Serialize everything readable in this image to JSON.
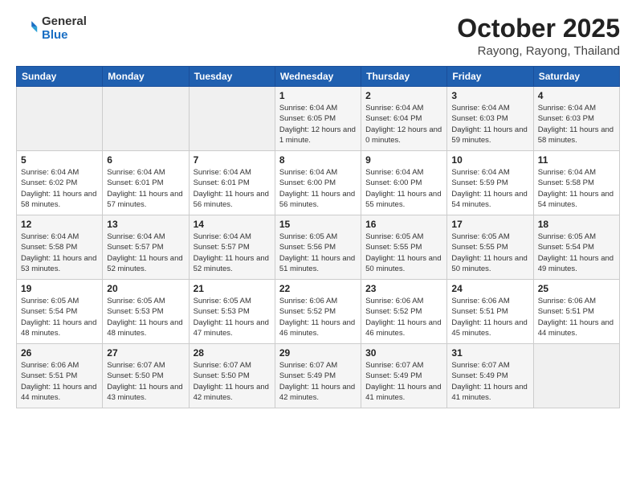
{
  "logo": {
    "general": "General",
    "blue": "Blue"
  },
  "header": {
    "month": "October 2025",
    "location": "Rayong, Rayong, Thailand"
  },
  "weekdays": [
    "Sunday",
    "Monday",
    "Tuesday",
    "Wednesday",
    "Thursday",
    "Friday",
    "Saturday"
  ],
  "weeks": [
    [
      {
        "day": "",
        "sunrise": "",
        "sunset": "",
        "daylight": ""
      },
      {
        "day": "",
        "sunrise": "",
        "sunset": "",
        "daylight": ""
      },
      {
        "day": "",
        "sunrise": "",
        "sunset": "",
        "daylight": ""
      },
      {
        "day": "1",
        "sunrise": "Sunrise: 6:04 AM",
        "sunset": "Sunset: 6:05 PM",
        "daylight": "Daylight: 12 hours and 1 minute."
      },
      {
        "day": "2",
        "sunrise": "Sunrise: 6:04 AM",
        "sunset": "Sunset: 6:04 PM",
        "daylight": "Daylight: 12 hours and 0 minutes."
      },
      {
        "day": "3",
        "sunrise": "Sunrise: 6:04 AM",
        "sunset": "Sunset: 6:03 PM",
        "daylight": "Daylight: 11 hours and 59 minutes."
      },
      {
        "day": "4",
        "sunrise": "Sunrise: 6:04 AM",
        "sunset": "Sunset: 6:03 PM",
        "daylight": "Daylight: 11 hours and 58 minutes."
      }
    ],
    [
      {
        "day": "5",
        "sunrise": "Sunrise: 6:04 AM",
        "sunset": "Sunset: 6:02 PM",
        "daylight": "Daylight: 11 hours and 58 minutes."
      },
      {
        "day": "6",
        "sunrise": "Sunrise: 6:04 AM",
        "sunset": "Sunset: 6:01 PM",
        "daylight": "Daylight: 11 hours and 57 minutes."
      },
      {
        "day": "7",
        "sunrise": "Sunrise: 6:04 AM",
        "sunset": "Sunset: 6:01 PM",
        "daylight": "Daylight: 11 hours and 56 minutes."
      },
      {
        "day": "8",
        "sunrise": "Sunrise: 6:04 AM",
        "sunset": "Sunset: 6:00 PM",
        "daylight": "Daylight: 11 hours and 56 minutes."
      },
      {
        "day": "9",
        "sunrise": "Sunrise: 6:04 AM",
        "sunset": "Sunset: 6:00 PM",
        "daylight": "Daylight: 11 hours and 55 minutes."
      },
      {
        "day": "10",
        "sunrise": "Sunrise: 6:04 AM",
        "sunset": "Sunset: 5:59 PM",
        "daylight": "Daylight: 11 hours and 54 minutes."
      },
      {
        "day": "11",
        "sunrise": "Sunrise: 6:04 AM",
        "sunset": "Sunset: 5:58 PM",
        "daylight": "Daylight: 11 hours and 54 minutes."
      }
    ],
    [
      {
        "day": "12",
        "sunrise": "Sunrise: 6:04 AM",
        "sunset": "Sunset: 5:58 PM",
        "daylight": "Daylight: 11 hours and 53 minutes."
      },
      {
        "day": "13",
        "sunrise": "Sunrise: 6:04 AM",
        "sunset": "Sunset: 5:57 PM",
        "daylight": "Daylight: 11 hours and 52 minutes."
      },
      {
        "day": "14",
        "sunrise": "Sunrise: 6:04 AM",
        "sunset": "Sunset: 5:57 PM",
        "daylight": "Daylight: 11 hours and 52 minutes."
      },
      {
        "day": "15",
        "sunrise": "Sunrise: 6:05 AM",
        "sunset": "Sunset: 5:56 PM",
        "daylight": "Daylight: 11 hours and 51 minutes."
      },
      {
        "day": "16",
        "sunrise": "Sunrise: 6:05 AM",
        "sunset": "Sunset: 5:55 PM",
        "daylight": "Daylight: 11 hours and 50 minutes."
      },
      {
        "day": "17",
        "sunrise": "Sunrise: 6:05 AM",
        "sunset": "Sunset: 5:55 PM",
        "daylight": "Daylight: 11 hours and 50 minutes."
      },
      {
        "day": "18",
        "sunrise": "Sunrise: 6:05 AM",
        "sunset": "Sunset: 5:54 PM",
        "daylight": "Daylight: 11 hours and 49 minutes."
      }
    ],
    [
      {
        "day": "19",
        "sunrise": "Sunrise: 6:05 AM",
        "sunset": "Sunset: 5:54 PM",
        "daylight": "Daylight: 11 hours and 48 minutes."
      },
      {
        "day": "20",
        "sunrise": "Sunrise: 6:05 AM",
        "sunset": "Sunset: 5:53 PM",
        "daylight": "Daylight: 11 hours and 48 minutes."
      },
      {
        "day": "21",
        "sunrise": "Sunrise: 6:05 AM",
        "sunset": "Sunset: 5:53 PM",
        "daylight": "Daylight: 11 hours and 47 minutes."
      },
      {
        "day": "22",
        "sunrise": "Sunrise: 6:06 AM",
        "sunset": "Sunset: 5:52 PM",
        "daylight": "Daylight: 11 hours and 46 minutes."
      },
      {
        "day": "23",
        "sunrise": "Sunrise: 6:06 AM",
        "sunset": "Sunset: 5:52 PM",
        "daylight": "Daylight: 11 hours and 46 minutes."
      },
      {
        "day": "24",
        "sunrise": "Sunrise: 6:06 AM",
        "sunset": "Sunset: 5:51 PM",
        "daylight": "Daylight: 11 hours and 45 minutes."
      },
      {
        "day": "25",
        "sunrise": "Sunrise: 6:06 AM",
        "sunset": "Sunset: 5:51 PM",
        "daylight": "Daylight: 11 hours and 44 minutes."
      }
    ],
    [
      {
        "day": "26",
        "sunrise": "Sunrise: 6:06 AM",
        "sunset": "Sunset: 5:51 PM",
        "daylight": "Daylight: 11 hours and 44 minutes."
      },
      {
        "day": "27",
        "sunrise": "Sunrise: 6:07 AM",
        "sunset": "Sunset: 5:50 PM",
        "daylight": "Daylight: 11 hours and 43 minutes."
      },
      {
        "day": "28",
        "sunrise": "Sunrise: 6:07 AM",
        "sunset": "Sunset: 5:50 PM",
        "daylight": "Daylight: 11 hours and 42 minutes."
      },
      {
        "day": "29",
        "sunrise": "Sunrise: 6:07 AM",
        "sunset": "Sunset: 5:49 PM",
        "daylight": "Daylight: 11 hours and 42 minutes."
      },
      {
        "day": "30",
        "sunrise": "Sunrise: 6:07 AM",
        "sunset": "Sunset: 5:49 PM",
        "daylight": "Daylight: 11 hours and 41 minutes."
      },
      {
        "day": "31",
        "sunrise": "Sunrise: 6:07 AM",
        "sunset": "Sunset: 5:49 PM",
        "daylight": "Daylight: 11 hours and 41 minutes."
      },
      {
        "day": "",
        "sunrise": "",
        "sunset": "",
        "daylight": ""
      }
    ]
  ]
}
